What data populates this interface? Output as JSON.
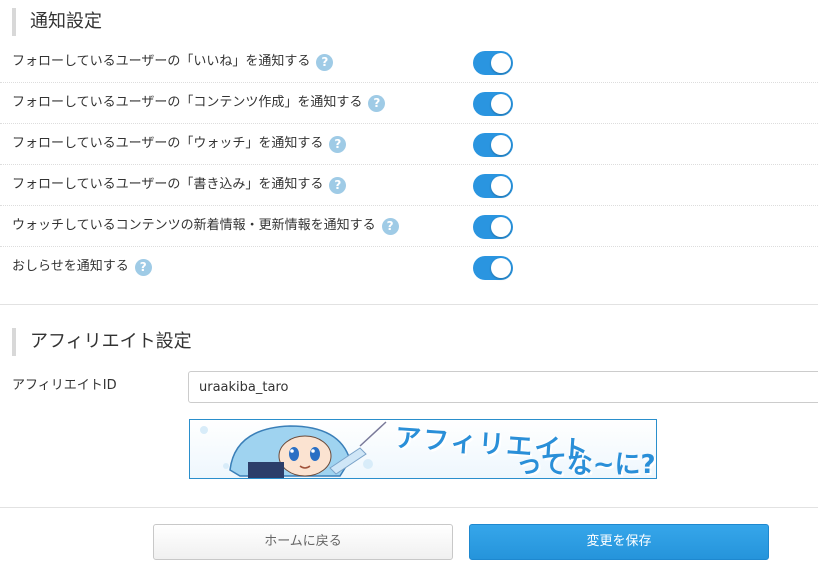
{
  "notifications": {
    "title": "通知設定",
    "items": [
      {
        "label": "フォローしているユーザーの「いいね」を通知する",
        "enabled": true
      },
      {
        "label": "フォローしているユーザーの「コンテンツ作成」を通知する",
        "enabled": true
      },
      {
        "label": "フォローしているユーザーの「ウォッチ」を通知する",
        "enabled": true
      },
      {
        "label": "フォローしているユーザーの「書き込み」を通知する",
        "enabled": true
      },
      {
        "label": "ウォッチしているコンテンツの新着情報・更新情報を通知する",
        "enabled": true
      },
      {
        "label": "おしらせを通知する",
        "enabled": true
      }
    ],
    "help_glyph": "?"
  },
  "affiliate": {
    "title": "アフィリエイト設定",
    "id_label": "アフィリエイトID",
    "id_value": "uraakiba_taro",
    "banner": {
      "line1": "アフィリエイト",
      "line2": "ってな~に?"
    }
  },
  "buttons": {
    "home_label": "ホームに戻る",
    "save_label": "変更を保存"
  },
  "colors": {
    "accent": "#2a95e0",
    "help_icon": "#9fcbe6"
  },
  "icons": {
    "help": "question-circle-icon",
    "toggle": "toggle-switch"
  }
}
